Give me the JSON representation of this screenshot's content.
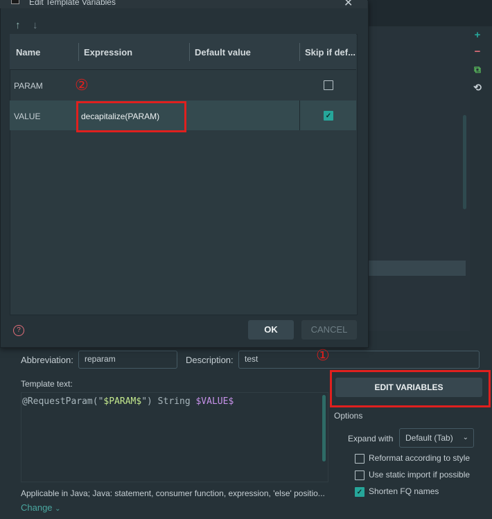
{
  "dialog": {
    "title": "Edit Template Variables",
    "close_glyph": "✕",
    "move_up_glyph": "↑",
    "move_down_glyph": "↓",
    "columns": [
      "Name",
      "Expression",
      "Default value",
      "Skip if def..."
    ],
    "rows": [
      {
        "name": "PARAM",
        "expression": "",
        "default_value": "",
        "skip": false
      },
      {
        "name": "VALUE",
        "expression": "decapitalize(PARAM)",
        "default_value": "",
        "skip": true
      }
    ],
    "help_glyph": "?",
    "ok_label": "OK",
    "cancel_label": "CANCEL"
  },
  "annotations": {
    "marker_1": "①",
    "marker_2": "②",
    "highlight_color": "#e0201e"
  },
  "sidebar": {
    "add_glyph": "+",
    "remove_glyph": "−",
    "copy_glyph": "⧉",
    "restore_glyph": "⟲"
  },
  "template_panel": {
    "abbreviation_label": "Abbreviation:",
    "abbreviation_value": "reparam",
    "description_label": "Description:",
    "description_value": "test",
    "template_text_label": "Template text:",
    "code_prefix": "@RequestParam(\"",
    "code_param": "$PARAM$",
    "code_middle": "\") String ",
    "code_value": "$VALUE$",
    "edit_variables_label": "EDIT VARIABLES",
    "options_label": "Options",
    "expand_with_label": "Expand with",
    "expand_with_value": "Default (Tab)",
    "options": [
      {
        "label": "Reformat according to style",
        "checked": false
      },
      {
        "label": "Use static import if possible",
        "checked": false
      },
      {
        "label": "Shorten FQ names",
        "checked": true
      }
    ],
    "applicable_text": "Applicable in Java; Java: statement, consumer function, expression, 'else' positio...",
    "change_label": "Change"
  },
  "colors": {
    "accent": "#26a69a",
    "background": "#263238"
  }
}
